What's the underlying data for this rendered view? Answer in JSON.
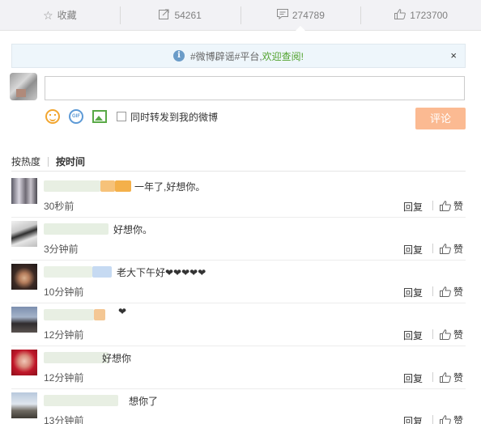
{
  "toolbar": {
    "favorite_label": "收藏",
    "forward_count": "54261",
    "comment_count": "274789",
    "like_count": "1723700"
  },
  "notice": {
    "prefix": "#微博辟谣#平台,",
    "link": "欢迎查阅!",
    "close": "×"
  },
  "compose": {
    "input_value": "",
    "repost_label": "同时转发到我的微博",
    "submit_label": "评论"
  },
  "sort": {
    "by_hot": "按热度",
    "by_time": "按时间"
  },
  "comment_actions": {
    "reply": "回复",
    "like": "赞"
  },
  "comments": [
    {
      "text": "一年了,好想你。",
      "time": "30秒前"
    },
    {
      "text": "好想你。",
      "time": "3分钟前"
    },
    {
      "text": "老大下午好❤❤❤❤❤",
      "time": "10分钟前"
    },
    {
      "text": "❤",
      "time": "12分钟前"
    },
    {
      "text": "好想你",
      "time": "12分钟前"
    },
    {
      "text": "想你了",
      "time": "13分钟前"
    }
  ],
  "colors": {
    "submit_bg": "#fbba92",
    "notice_link": "#52a32f",
    "heart": "#e23b3b"
  }
}
